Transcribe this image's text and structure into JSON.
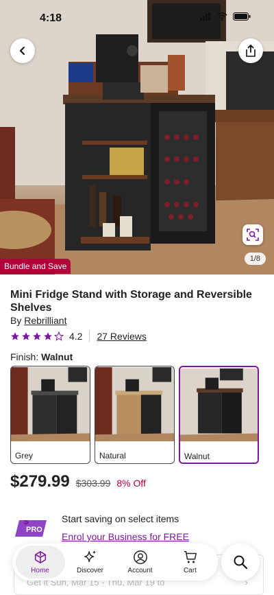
{
  "status_bar": {
    "time": "4:18"
  },
  "gallery": {
    "image_counter": "1/8",
    "bundle_badge": "Bundle and Save"
  },
  "product": {
    "title": "Mini Fridge Stand with Storage and Reversible Shelves",
    "brand_prefix": "By",
    "brand": "Rebrilliant",
    "rating": "4.2",
    "rating_value": 4.2,
    "reviews_link": "27 Reviews",
    "finish_label": "Finish:",
    "finish_value": "Walnut",
    "finishes": [
      {
        "label": "Grey",
        "selected": false
      },
      {
        "label": "Natural",
        "selected": false
      },
      {
        "label": "Walnut",
        "selected": true
      }
    ],
    "price": "$279.99",
    "old_price": "$303.99",
    "discount": "8% Off"
  },
  "pro": {
    "badge": "PRO",
    "text": "Start saving on select items",
    "link": "Enrol your Business for FREE"
  },
  "delivery": {
    "text": "Get it Sun, Mar 15 - Thu, Mar 19 to"
  },
  "nav": {
    "home": "Home",
    "discover": "Discover",
    "account": "Account",
    "cart": "Cart"
  },
  "colors": {
    "accent": "#7b189f",
    "sale": "#b3003b"
  }
}
